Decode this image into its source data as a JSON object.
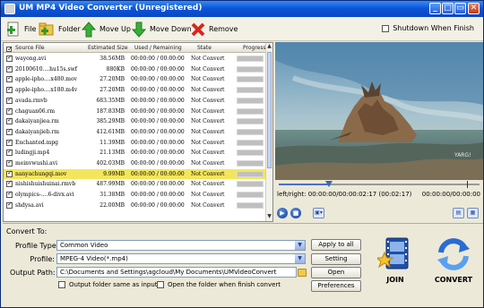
{
  "window": {
    "title": "UM MP4 Video Converter (Unregistered)",
    "controls": [
      "_",
      "□",
      "▭",
      "✕"
    ]
  },
  "toolbar": {
    "file_label": "File",
    "folder_label": "Folder",
    "move_up_label": "Move Up",
    "move_down_label": "Move Down",
    "remove_label": "Remove",
    "shutdown_label": "Shutdown When Finish",
    "shutdown_checked": false
  },
  "filelist": {
    "columns": {
      "source": "Source File",
      "size": "Estimated Size",
      "used": "Used / Remaining",
      "state": "State",
      "progress": "Progress"
    },
    "rows": [
      {
        "name": "wayong.avi",
        "size": "38.56MB",
        "used": "00:00:00 / 00:00:00",
        "state": "Not Convert",
        "checked": true,
        "selected": false
      },
      {
        "name": "20100610....hu15s.swf",
        "size": "880KB",
        "used": "00:00:00 / 00:00:00",
        "state": "Not Convert",
        "checked": true,
        "selected": false
      },
      {
        "name": "apple-ipho....x480.mov",
        "size": "27.20MB",
        "used": "00:00:00 / 00:00:00",
        "state": "Not Convert",
        "checked": true,
        "selected": false
      },
      {
        "name": "apple-ipho....x180.m4v",
        "size": "27.20MB",
        "used": "00:00:00 / 00:00:00",
        "state": "Not Convert",
        "checked": true,
        "selected": false
      },
      {
        "name": "avada.rmvb",
        "size": "683.35MB",
        "used": "00:00:00 / 00:00:00",
        "state": "Not Convert",
        "checked": true,
        "selected": false
      },
      {
        "name": "chaguan06.rm",
        "size": "187.83MB",
        "used": "00:00:00 / 00:00:00",
        "state": "Not Convert",
        "checked": true,
        "selected": false
      },
      {
        "name": "dakaiyanjiea.rm",
        "size": "385.29MB",
        "used": "00:00:00 / 00:00:00",
        "state": "Not Convert",
        "checked": true,
        "selected": false
      },
      {
        "name": "dakaiyanjieb.rm",
        "size": "412.61MB",
        "used": "00:00:00 / 00:00:00",
        "state": "Not Convert",
        "checked": true,
        "selected": false
      },
      {
        "name": "Enchanted.mpg",
        "size": "11.39MB",
        "used": "00:00:00 / 00:00:00",
        "state": "Not Convert",
        "checked": true,
        "selected": false
      },
      {
        "name": "ludingji.mp4",
        "size": "21.13MB",
        "used": "00:00:00 / 00:00:00",
        "state": "Not Convert",
        "checked": true,
        "selected": false
      },
      {
        "name": "meinvwushi.avi",
        "size": "402.03MB",
        "used": "00:00:00 / 00:00:00",
        "state": "Not Convert",
        "checked": true,
        "selected": false
      },
      {
        "name": "nanyachungqi.mov",
        "size": "9.99MB",
        "used": "00:00:00 / 00:00:00",
        "state": "Not Convert",
        "checked": true,
        "selected": true
      },
      {
        "name": "nishishuishuinai.rmvb",
        "size": "487.99MB",
        "used": "00:00:00 / 00:00:00",
        "state": "Not Convert",
        "checked": true,
        "selected": false
      },
      {
        "name": "olympics-....6-divx.avi",
        "size": "31.38MB",
        "used": "00:00:00 / 00:00:00",
        "state": "Not Convert",
        "checked": true,
        "selected": false
      },
      {
        "name": "shdysa.avi",
        "size": "22.00MB",
        "used": "00:00:00 / 00:00:00",
        "state": "Not Convert",
        "checked": true,
        "selected": false
      }
    ]
  },
  "preview": {
    "watermark": "YARG!",
    "seek_progress": 0.25,
    "left_right_label": "left/right:",
    "left_right_value": "00:00:00/00:00:02:17 (00:02:17)",
    "position_value": "00:00:00/00:00:00"
  },
  "convert": {
    "title": "Convert To:",
    "profile_type_label": "Profile Type:",
    "profile_type_value": "Common Video",
    "profile_label": "Profile:",
    "profile_value": "MPEG-4 Video(*.mp4)",
    "output_path_label": "Output Path:",
    "output_path_value": "C:\\Documents and Settings\\agcloud\\My Documents\\UMVideoConvert",
    "apply_all_label": "Apply to all",
    "setting_label": "Setting",
    "open_label": "Open",
    "preferences_label": "Preferences",
    "same_as_input_label": "Output folder same as input",
    "open_when_finish_label": "Open the folder when finish convert",
    "join_label": "JOIN",
    "convert_label": "CONVERT"
  },
  "colors": {
    "selected_row": "#f3e65c",
    "titlebar": "#0b55d8",
    "window_bg": "#ece9d8",
    "accent_blue": "#2a6bd4"
  }
}
